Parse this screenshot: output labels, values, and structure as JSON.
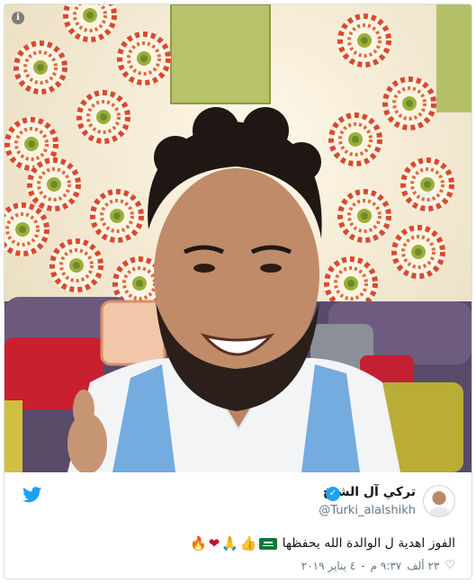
{
  "photo": {
    "info_glyph": "i",
    "alt_description": ""
  },
  "tweet": {
    "display_name": "تركي آل الشيخ",
    "handle": "@Turki_alalshikh",
    "text": "الفوز اهدية ل الوالدة الله يحفظها",
    "likes": "٢٣ ألف",
    "time": "٩:٣٧ م",
    "date": "٤ يناير ٢٠١٩",
    "time_date_separator": "-"
  },
  "icons": {
    "twitter": "twitter-bird-icon",
    "verified": "verified-badge-icon",
    "heart": "heart-icon",
    "info": "info-icon"
  },
  "colors": {
    "twitter_blue": "#1da1f2",
    "text": "#14171a",
    "muted": "#657786",
    "jersey_blue": "#74acdf"
  }
}
